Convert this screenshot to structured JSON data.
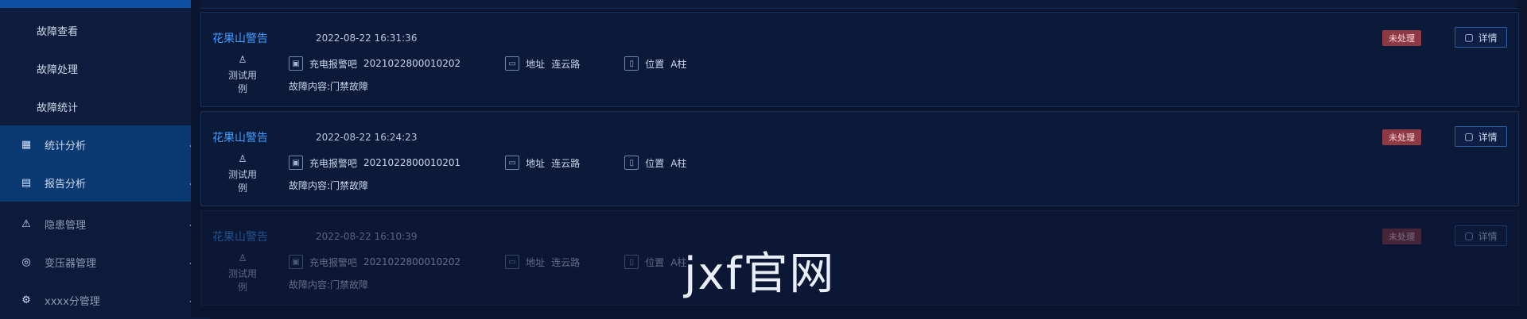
{
  "sidebar": {
    "items": [
      {
        "label": "故障查看",
        "type": "sub"
      },
      {
        "label": "故障处理",
        "type": "sub"
      },
      {
        "label": "故障统计",
        "type": "sub"
      },
      {
        "label": "统计分析",
        "type": "main",
        "icon": "chart-icon",
        "state": "active"
      },
      {
        "label": "报告分析",
        "type": "main",
        "icon": "report-icon",
        "state": "active"
      },
      {
        "label": "隐患管理",
        "type": "main",
        "icon": "warning-icon",
        "state": "dim"
      },
      {
        "label": "变压器管理",
        "type": "main",
        "icon": "transformer-icon",
        "state": "dim"
      },
      {
        "label": "xxxx分管理",
        "type": "main",
        "icon": "settings-icon",
        "state": "dim"
      }
    ]
  },
  "alarms": [
    {
      "title": "花果山警告",
      "time": "2022-08-22 16:31:36",
      "user": "测试用例",
      "device_label": "充电报警吧",
      "device_value": "2021022800010202",
      "address_label": "地址",
      "address_value": "连云路",
      "position_label": "位置",
      "position_value": "A柱",
      "description": "故障内容:门禁故障",
      "status": "未处理",
      "detail_label": "详情"
    },
    {
      "title": "花果山警告",
      "time": "2022-08-22 16:24:23",
      "user": "测试用例",
      "device_label": "充电报警吧",
      "device_value": "2021022800010201",
      "address_label": "地址",
      "address_value": "连云路",
      "position_label": "位置",
      "position_value": "A柱",
      "description": "故障内容:门禁故障",
      "status": "未处理",
      "detail_label": "详情"
    },
    {
      "title": "花果山警告",
      "time": "2022-08-22 16:10:39",
      "user": "测试用例",
      "device_label": "充电报警吧",
      "device_value": "2021022800010202",
      "address_label": "地址",
      "address_value": "连云路",
      "position_label": "位置",
      "position_value": "A柱",
      "description": "故障内容:门禁故障",
      "status": "未处理",
      "detail_label": "详情"
    }
  ],
  "watermark": "jxf官网"
}
